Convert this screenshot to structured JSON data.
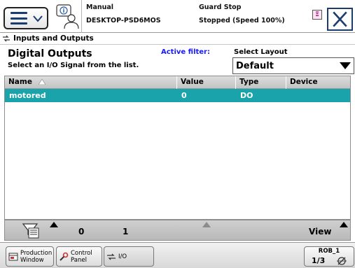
{
  "header": {
    "mode": "Manual",
    "system_name": "DESKTOP-PSD6MOS",
    "guard_status": "Guard Stop",
    "run_status": "Stopped (Speed 100%)"
  },
  "app": {
    "title": "Inputs and Outputs"
  },
  "view": {
    "title": "Digital Outputs",
    "subtitle": "Select an I/O Signal from the list.",
    "active_filter_label": "Active filter:",
    "layout_label": "Select Layout",
    "layout_value": "Default"
  },
  "table": {
    "columns": [
      "Name",
      "Value",
      "Type",
      "Device"
    ],
    "rows": [
      {
        "name": "motored",
        "value": "0",
        "type": "DO",
        "device": ""
      }
    ],
    "selected_row_color": "#1ba3ab"
  },
  "toolbar": {
    "zero_label": "0",
    "one_label": "1",
    "view_label": "View"
  },
  "taskbar": {
    "items": [
      {
        "label": "Production\nWindow",
        "icon": "production-window-icon"
      },
      {
        "label": "Control\nPanel",
        "icon": "control-panel-icon"
      },
      {
        "label": "I/O",
        "icon": "io-icon"
      }
    ],
    "robot": {
      "name": "ROB_1",
      "speed_fraction": "1/3",
      "icon": "coordinate-system-icon"
    }
  },
  "colors": {
    "accent": "#1a3c6e",
    "selection": "#1ba3ab",
    "filter_text": "#1a1aff"
  }
}
